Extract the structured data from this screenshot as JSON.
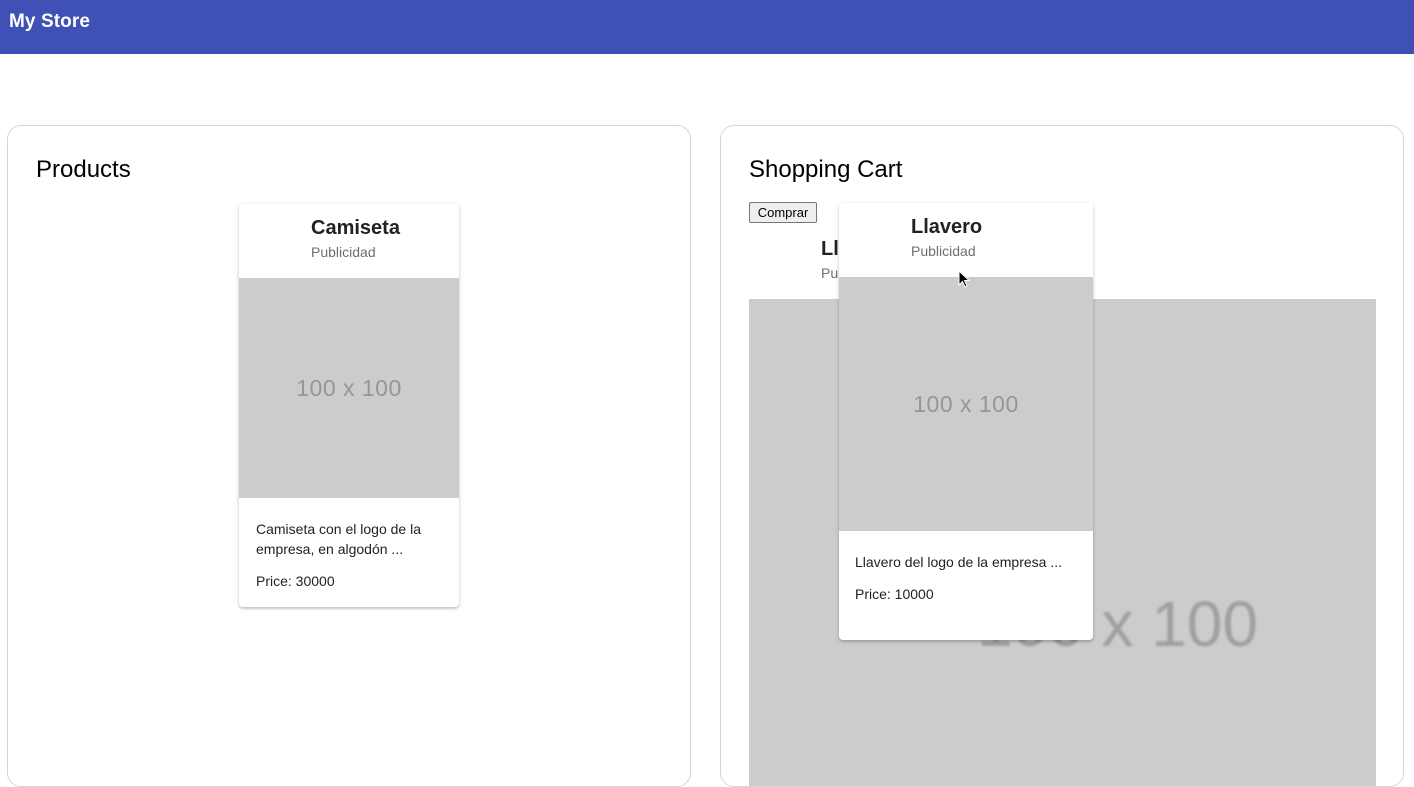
{
  "app": {
    "title": "My Store",
    "brand_color": "#3f51b5"
  },
  "products": {
    "title": "Products",
    "items": [
      {
        "name": "Camiseta",
        "subtitle": "Publicidad",
        "image_placeholder": "100 x 100",
        "description": "Camiseta con el logo de la empresa, en algodón ...",
        "price_text": "Price: 30000"
      }
    ]
  },
  "cart": {
    "title": "Shopping Cart",
    "buy_label": "Comprar",
    "items": [
      {
        "name": "Llavero",
        "subtitle": "Publicidad",
        "image_placeholder": "100 x 100"
      }
    ]
  },
  "drag": {
    "name": "Llavero",
    "subtitle": "Publicidad",
    "image_placeholder": "100 x 100",
    "description": "Llavero del logo de la empresa ...",
    "price_text": "Price: 10000"
  }
}
